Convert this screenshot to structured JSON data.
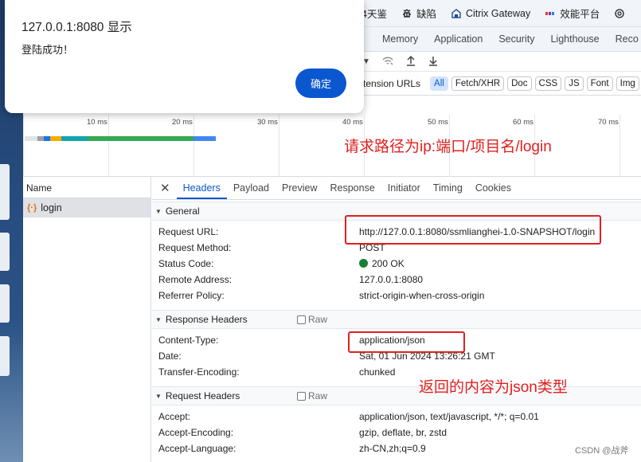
{
  "dialog": {
    "title": "127.0.0.1:8080 显示",
    "message": "登陆成功！",
    "ok_label": "确定"
  },
  "bookmarks": [
    {
      "label": "4天鉴",
      "icon": "bookmark-icon"
    },
    {
      "label": "缺陷",
      "icon": "bug-icon"
    },
    {
      "label": "Citrix Gateway",
      "icon": "citrix-icon"
    },
    {
      "label": "效能平台",
      "icon": "platform-icon"
    },
    {
      "label": "",
      "icon": "openai-icon"
    }
  ],
  "devtools_tabs": [
    "Memory",
    "Application",
    "Security",
    "Lighthouse",
    "Reco"
  ],
  "filter_text": "tension URLs",
  "filters": [
    "All",
    "Fetch/XHR",
    "Doc",
    "CSS",
    "JS",
    "Font",
    "Img"
  ],
  "timeline_ticks": [
    "10 ms",
    "20 ms",
    "30 ms",
    "40 ms",
    "50 ms",
    "60 ms",
    "70 ms"
  ],
  "name_panel": {
    "header": "Name",
    "rows": [
      {
        "icon": "{·}",
        "name": "login"
      }
    ]
  },
  "sub_tabs": [
    "Headers",
    "Payload",
    "Preview",
    "Response",
    "Initiator",
    "Timing",
    "Cookies"
  ],
  "general": {
    "title": "General",
    "rows": [
      {
        "key": "Request URL:",
        "value": "http://127.0.0.1:8080/ssmlianghei-1.0-SNAPSHOT/login"
      },
      {
        "key": "Request Method:",
        "value": "POST"
      },
      {
        "key": "Status Code:",
        "value": "200 OK"
      },
      {
        "key": "Remote Address:",
        "value": "127.0.0.1:8080"
      },
      {
        "key": "Referrer Policy:",
        "value": "strict-origin-when-cross-origin"
      }
    ]
  },
  "response_headers": {
    "title": "Response Headers",
    "raw_label": "Raw",
    "rows": [
      {
        "key": "Content-Type:",
        "value": "application/json"
      },
      {
        "key": "Date:",
        "value": "Sat, 01 Jun 2024 13:26:21 GMT"
      },
      {
        "key": "Transfer-Encoding:",
        "value": "chunked"
      }
    ]
  },
  "request_headers": {
    "title": "Request Headers",
    "raw_label": "Raw",
    "rows": [
      {
        "key": "Accept:",
        "value": "application/json, text/javascript, */*; q=0.01"
      },
      {
        "key": "Accept-Encoding:",
        "value": "gzip, deflate, br, zstd"
      },
      {
        "key": "Accept-Language:",
        "value": "zh-CN,zh;q=0.9"
      }
    ]
  },
  "annotations": {
    "path_note": "请求路径为ip:端口/项目名/login",
    "json_note": "返回的内容为json类型"
  },
  "watermark": "CSDN @战斧",
  "colors": {
    "accent": "#0b57d0",
    "annotation_red": "#e02020",
    "status_ok": "#188038"
  }
}
